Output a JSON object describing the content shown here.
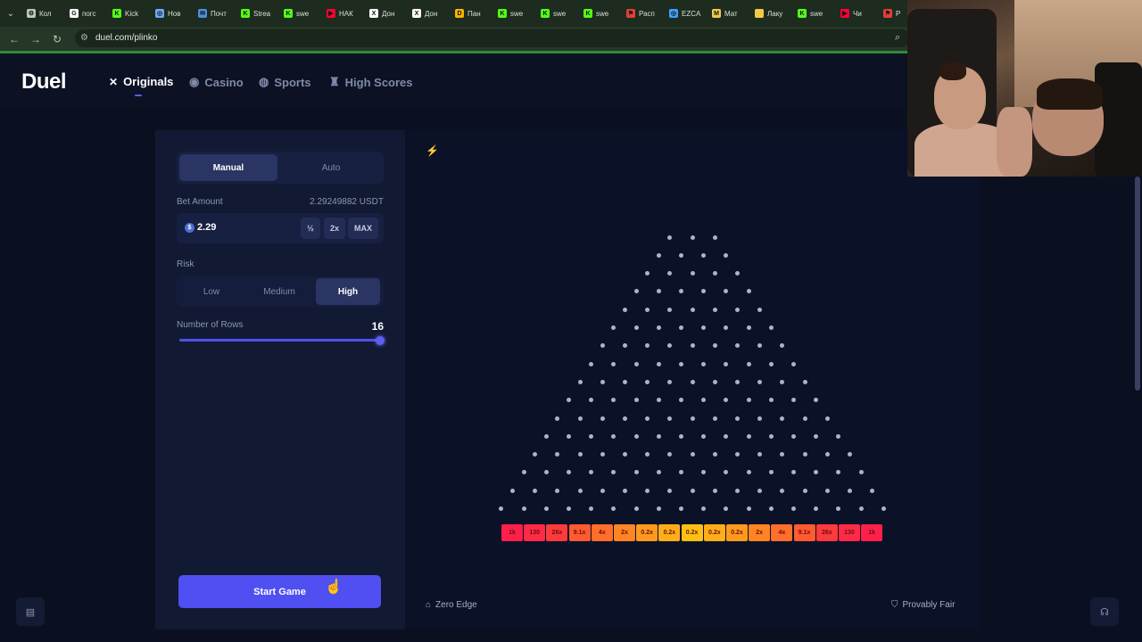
{
  "browser": {
    "tabs": [
      {
        "label": "Кол",
        "icon": "settings-icon",
        "color": "#bfc5bf"
      },
      {
        "label": "погс",
        "icon": "google-icon",
        "color": "#ffffff"
      },
      {
        "label": "Kick",
        "icon": "kick-icon",
        "color": "#53fc18"
      },
      {
        "label": "Нов",
        "icon": "globe-icon",
        "color": "#6ea8ff"
      },
      {
        "label": "Почт",
        "icon": "mail-icon",
        "color": "#4a90e2"
      },
      {
        "label": "Strea",
        "icon": "kick-icon",
        "color": "#53fc18"
      },
      {
        "label": "swe",
        "icon": "kick-icon",
        "color": "#53fc18"
      },
      {
        "label": "НАК",
        "icon": "youtube-icon",
        "color": "#ff0033"
      },
      {
        "label": "Дон",
        "icon": "x-icon",
        "color": "#ffffff"
      },
      {
        "label": "Дон",
        "icon": "x-icon",
        "color": "#ffffff"
      },
      {
        "label": "Пан",
        "icon": "d-icon",
        "color": "#f5b400"
      },
      {
        "label": "swe",
        "icon": "kick-icon",
        "color": "#53fc18"
      },
      {
        "label": "swe",
        "icon": "kick-icon",
        "color": "#53fc18"
      },
      {
        "label": "swe",
        "icon": "kick-icon",
        "color": "#53fc18"
      },
      {
        "label": "Расп",
        "icon": "flag-icon",
        "color": "#e0403a"
      },
      {
        "label": "EZCA",
        "icon": "globe-icon",
        "color": "#3fa0ff"
      },
      {
        "label": "Мат",
        "icon": "m-icon",
        "color": "#f2c94c"
      },
      {
        "label": "Лаку",
        "icon": "lightning-icon",
        "color": "#f2c94c"
      },
      {
        "label": "swe",
        "icon": "kick-icon",
        "color": "#53fc18"
      },
      {
        "label": "Чи",
        "icon": "youtube-icon",
        "color": "#ff0033"
      },
      {
        "label": "Р",
        "icon": "flag-icon",
        "color": "#e0403a"
      }
    ],
    "url": "duel.com/plinko"
  },
  "site": {
    "logo": "Duel",
    "nav": [
      {
        "label": "Originals",
        "icon": "originals-icon",
        "active": true
      },
      {
        "label": "Casino",
        "icon": "casino-icon",
        "active": false
      },
      {
        "label": "Sports",
        "icon": "sports-icon",
        "active": false
      },
      {
        "label": "High Scores",
        "icon": "trophy-icon",
        "active": false
      }
    ]
  },
  "panel": {
    "modes": [
      "Manual",
      "Auto"
    ],
    "active_mode": "Manual",
    "bet_label": "Bet Amount",
    "balance": "2.29249882 USDT",
    "bet_value": "2.29",
    "currency_symbol": "$",
    "half_label": "½",
    "double_label": "2x",
    "max_label": "MAX",
    "risk_label": "Risk",
    "risk_options": [
      "Low",
      "Medium",
      "High"
    ],
    "active_risk": "High",
    "rows_label": "Number of Rows",
    "rows_value": "16",
    "rows_fraction": 1.0,
    "start_label": "Start Game"
  },
  "game": {
    "rows": 16,
    "multipliers": [
      "1k",
      "130",
      "26x",
      "9.1x",
      "4x",
      "2x",
      "0.2x",
      "0.2x",
      "0.2x",
      "0.2x",
      "0.2x",
      "2x",
      "4x",
      "9.1x",
      "26x",
      "130",
      "1k"
    ],
    "slot_colors": [
      "#ff1f4b",
      "#ff2a45",
      "#ff3a3c",
      "#ff5a30",
      "#ff6e2a",
      "#ff8424",
      "#ff9a1f",
      "#ffae1a",
      "#ffc014",
      "#ffae1a",
      "#ff9a1f",
      "#ff8424",
      "#ff6e2a",
      "#ff5a30",
      "#ff3a3c",
      "#ff2a45",
      "#ff1f4b"
    ],
    "footer_left": "Zero Edge",
    "footer_right": "Provably Fair"
  },
  "colors": {
    "accent": "#4f4ff2",
    "background": "#0b1020",
    "panel": "#121a33"
  }
}
